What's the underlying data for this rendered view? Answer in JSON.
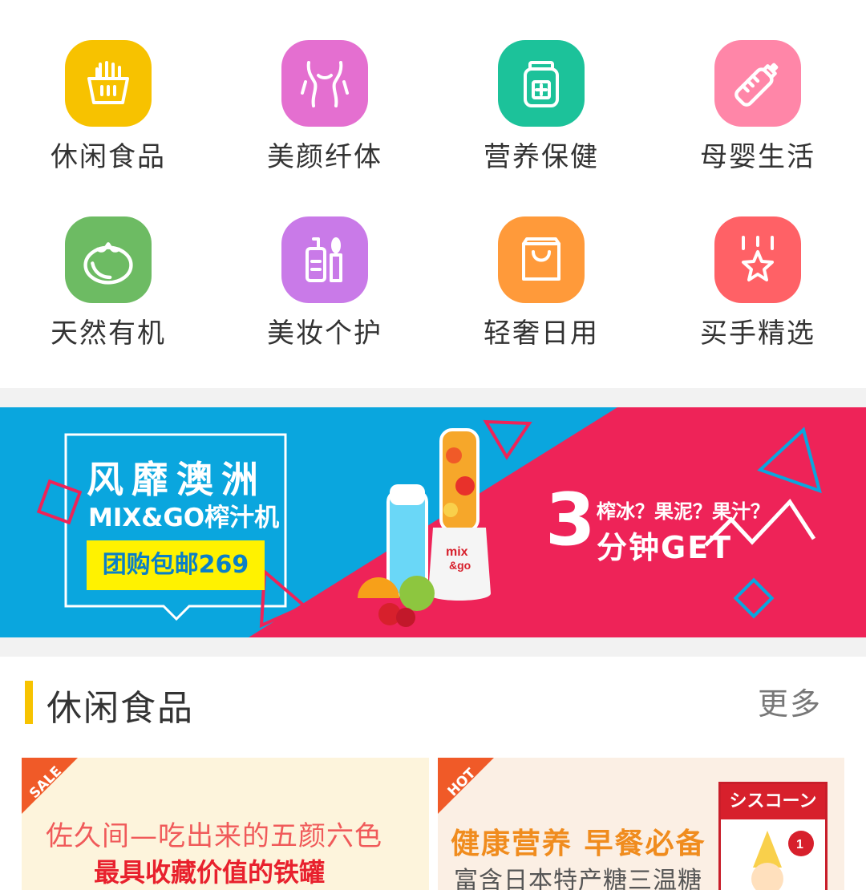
{
  "categories": [
    {
      "label": "休闲食品",
      "icon": "fries-basket-icon",
      "color": "#f7c200"
    },
    {
      "label": "美颜纤体",
      "icon": "body-figure-icon",
      "color": "#e46fd0"
    },
    {
      "label": "营养保健",
      "icon": "medicine-bottle-icon",
      "color": "#1cc29a"
    },
    {
      "label": "母婴生活",
      "icon": "baby-bottle-icon",
      "color": "#ff86a8"
    },
    {
      "label": "天然有机",
      "icon": "tomato-icon",
      "color": "#6dbb63"
    },
    {
      "label": "美妆个护",
      "icon": "cosmetics-icon",
      "color": "#c97ae8"
    },
    {
      "label": "轻奢日用",
      "icon": "shopping-bag-icon",
      "color": "#ff9a3a"
    },
    {
      "label": "买手精选",
      "icon": "star-ribbon-icon",
      "color": "#ff6166"
    }
  ],
  "banner": {
    "headline": "风靡澳洲",
    "product": "MIX&GO榨汁机",
    "deal": "团购包邮269",
    "bottle_text": "mix & go",
    "question": "榨冰？果泥？果汁？",
    "number": "3",
    "tagline": "分钟GET"
  },
  "section": {
    "title": "休闲食品",
    "more": "更多"
  },
  "cards": [
    {
      "ribbon": "SALE",
      "line1": "佐久间—吃出来的五颜六色",
      "line2": "最具收藏价值的铁罐",
      "ribbon_color": "#f05a28"
    },
    {
      "ribbon": "HOT",
      "line1": "健康营养 早餐必备",
      "line2": "富含日本特产糖三温糖",
      "product_title": "シスコーンBIG",
      "ribbon_color": "#f05a28"
    }
  ]
}
